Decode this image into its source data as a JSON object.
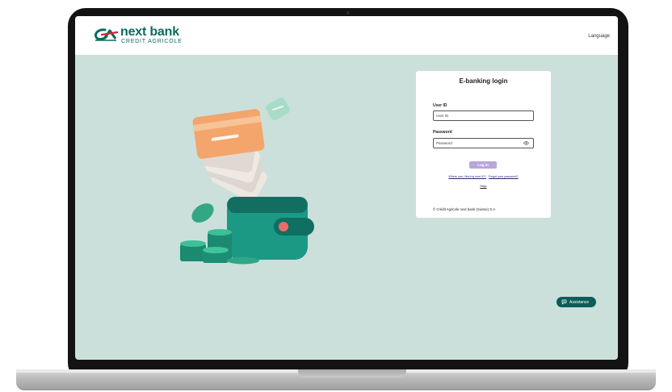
{
  "header": {
    "logo_name": "next bank",
    "logo_subtitle": "CREDIT AGRICOLE",
    "language_label": "Language"
  },
  "login": {
    "title": "E-banking login",
    "user_id_label": "User ID",
    "user_id_placeholder": "User ID",
    "password_label": "Password",
    "password_placeholder": "Password",
    "login_button": "Log in",
    "find_user_id_link": "Where can I find my user ID?",
    "forgot_password_link": "Forgot your password?",
    "help_link": "Help",
    "copyright": "© Crédit Agricole next bank (Suisse) S.A"
  },
  "assistance": {
    "label": "Assistance"
  },
  "icons": {
    "logo": "credit-agricole-logo-icon",
    "password_toggle": "eye-icon",
    "assistance": "chat-bubble-icon"
  },
  "colors": {
    "brand_teal": "#0b6a62",
    "background_mint": "#cbe0db",
    "login_button_lavender": "#b8a6d9",
    "assistance_button": "#0b5d59"
  }
}
